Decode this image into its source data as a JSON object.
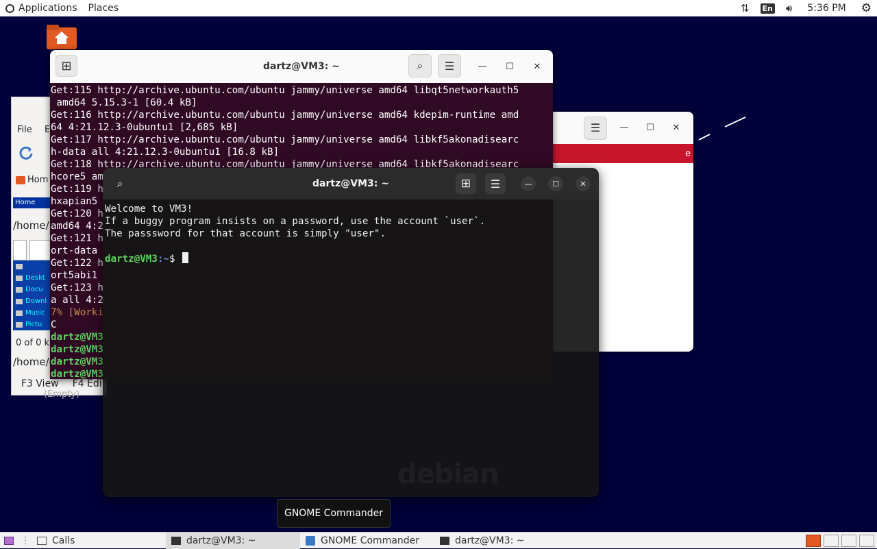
{
  "top_panel": {
    "applications": "Applications",
    "places": "Places",
    "language": "En",
    "clock": "5:36 PM"
  },
  "gcmd": {
    "menu_file": "File",
    "menu_e": "E",
    "home_btn": "Hom",
    "home_tab": "Home",
    "path": "/home/",
    "files": [
      "",
      "Deskt",
      "Docu",
      "Downl",
      "Music",
      "Pictu"
    ],
    "count": "0 of 0 k",
    "path2": "/home/d",
    "f3": "F3 View",
    "f4": "F4 Edi",
    "empty": "(Empty)"
  },
  "white_window": {
    "redbar_text": "e"
  },
  "term1": {
    "title": "dartz@VM3: ~",
    "lines": [
      "Get:115 http://archive.ubuntu.com/ubuntu jammy/universe amd64 libqt5networkauth5",
      " amd64 5.15.3-1 [60.4 kB]",
      "Get:116 http://archive.ubuntu.com/ubuntu jammy/universe amd64 kdepim-runtime amd",
      "64 4:21.12.3-0ubuntu1 [2,685 kB]",
      "Get:117 http://archive.ubuntu.com/ubuntu jammy/universe amd64 libkf5akonadisearc",
      "h-data all 4:21.12.3-0ubuntu1 [16.8 kB]",
      "Get:118 http://archive.ubuntu.com/ubuntu jammy/universe amd64 libkf5akonadisearc",
      "hcore5 am",
      "Get:119 h",
      "hxapian5",
      "Get:120 h",
      "amd64 4:2",
      "Get:121 h",
      "ort-data",
      "Get:122 h",
      "ort5abi1",
      "Get:123 h",
      "a all 4:2"
    ],
    "working": "7% [Worki",
    "ctrl_c": "C",
    "prompt_user": "dartz@VM3",
    "prompt_count": 4
  },
  "term2": {
    "title": "dartz@VM3: ~",
    "lines": [
      "Welcome to VM3!",
      "If a buggy program insists on a password, use the account `user`.",
      "The passsword for that account is simply \"user\"."
    ],
    "prompt_user": "dartz@VM3",
    "prompt_path": ":~",
    "prompt_sign": "$ ",
    "watermark": "debian"
  },
  "tooltip": "GNOME Commander",
  "taskbar": {
    "items": [
      {
        "label": "Calls"
      },
      {
        "label": "dartz@VM3: ~"
      },
      {
        "label": "GNOME Commander"
      },
      {
        "label": "dartz@VM3: ~"
      }
    ]
  },
  "colors": {
    "desktop_bg": "#00003a",
    "term1_bg": "#300a24",
    "term2_bg": "#161616",
    "accent_red": "#c7162b",
    "prompt_green": "#5fd35f"
  }
}
